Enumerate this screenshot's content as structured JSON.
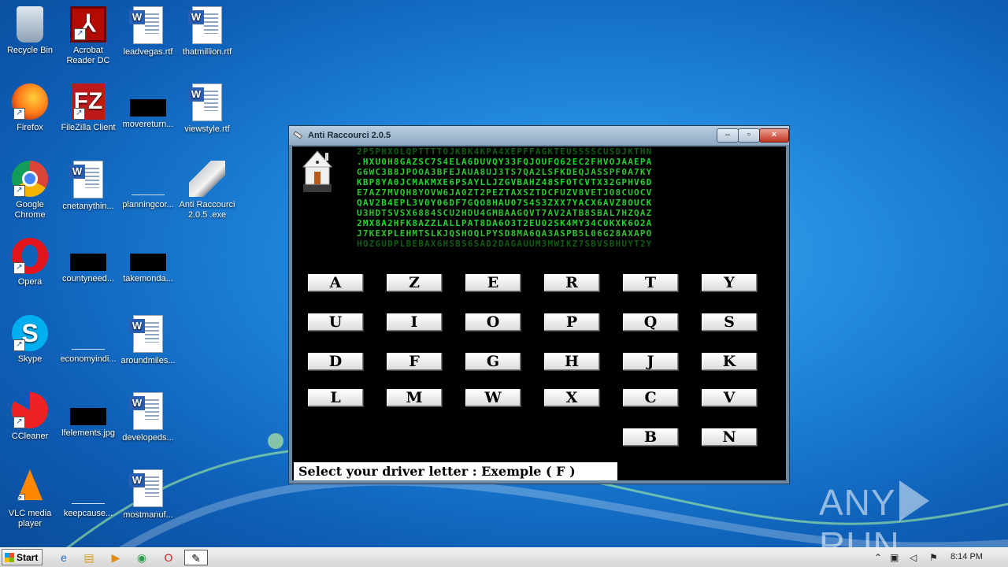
{
  "desktop": {
    "icons": [
      {
        "label": "Recycle Bin",
        "glyph": "recycle-bin-icon"
      },
      {
        "label": "Acrobat Reader DC",
        "glyph": "acrobat-icon"
      },
      {
        "label": "leadvegas.rtf",
        "glyph": "word-doc-icon"
      },
      {
        "label": "thatmillion.rtf",
        "glyph": "word-doc-icon"
      },
      {
        "label": "Firefox",
        "glyph": "firefox-icon"
      },
      {
        "label": "FileZilla Client",
        "glyph": "filezilla-icon"
      },
      {
        "label": "movereturn...",
        "glyph": "black-thumb-icon"
      },
      {
        "label": "viewstyle.rtf",
        "glyph": "word-doc-icon"
      },
      {
        "label": "Google Chrome",
        "glyph": "chrome-icon"
      },
      {
        "label": "cnetanythin...",
        "glyph": "word-doc-icon"
      },
      {
        "label": "planningcor...",
        "glyph": "blank-file-icon"
      },
      {
        "label": "Anti Raccourci 2.0.5 .exe",
        "glyph": "usb-icon"
      },
      {
        "label": "Opera",
        "glyph": "opera-icon"
      },
      {
        "label": "countyneed...",
        "glyph": "black-thumb-icon"
      },
      {
        "label": "takemonda...",
        "glyph": "black-thumb-icon"
      },
      {
        "label": "Skype",
        "glyph": "skype-icon"
      },
      {
        "label": "economyindi...",
        "glyph": "blank-file-icon"
      },
      {
        "label": "aroundmiles...",
        "glyph": "word-doc-icon"
      },
      {
        "label": "CCleaner",
        "glyph": "ccleaner-icon"
      },
      {
        "label": "lfelements.jpg",
        "glyph": "black-thumb-icon"
      },
      {
        "label": "developeds...",
        "glyph": "word-doc-icon"
      },
      {
        "label": "VLC media player",
        "glyph": "vlc-icon"
      },
      {
        "label": "keepcause...",
        "glyph": "blank-file-icon"
      },
      {
        "label": "mostmanuf...",
        "glyph": "word-doc-icon"
      }
    ]
  },
  "window": {
    "title": "Anti Raccourci 2.0.5",
    "minimize": "–",
    "maximize": "▫",
    "close": "×",
    "matrix_lines": [
      "2P5PHXOLQPTTTTOJKBK4KPA4XEPFFAGKTEUSSSSCUSDJKTHN",
      ".HXU0H8GAZSC7S4ELA6DUVQY33FQJOUFQ62EC2FHVOJAAEPA",
      "G6WC3B8JPOOA3BFEJAUA8UJ3TS7QA2LSFKDEQJASSPF0A7KY",
      "KBP8YA0JCMAKMXE6PSAYLLJZGVBAHZ48SFOTCVTX32GPHV6D",
      "E7AZ7MVQH8YOVW6JA0ZT2PEZTAXSZTDCFUZV8VETJ08CUOCV",
      "QAV2B4EPL3V0Y06DF7GQO8HAU07S4S3ZXX7YACX6AVZ8OUCK",
      "U3HDTSVSX6884SCU2HDU4GMBAAGQVT7AV2ATB8SBAL7HZQAZ",
      "2MX8A2HFK8AZZLALLPAT8DA6O3T2EU02SK4MY34C0KXK6O2A",
      "J7KEXPLEHMTSLKJQSHOQLPYSD8MA6QA3ASPB5L06G28AXAPO",
      "HQZGUDPLBEBAX6HSBS6SAD2DAGAUUM3MWIKZ7SBVSBHUYT2Y"
    ],
    "keys": [
      [
        "A",
        "Z",
        "E",
        "R",
        "T",
        "Y"
      ],
      [
        "U",
        "I",
        "O",
        "P",
        "Q",
        "S"
      ],
      [
        "D",
        "F",
        "G",
        "H",
        "J",
        "K"
      ],
      [
        "L",
        "M",
        "W",
        "X",
        "C",
        "V"
      ],
      [
        "B",
        "N"
      ]
    ],
    "status_text": "Select your driver letter : Exemple ( F )"
  },
  "watermark": {
    "text_left": "ANY",
    "text_right": "RUN"
  },
  "taskbar": {
    "start_label": "Start",
    "pinned": [
      "ie-icon",
      "explorer-icon",
      "media-player-icon",
      "chrome-icon",
      "opera-icon",
      "anti-raccourci-icon"
    ],
    "clock": "8:14 PM"
  }
}
